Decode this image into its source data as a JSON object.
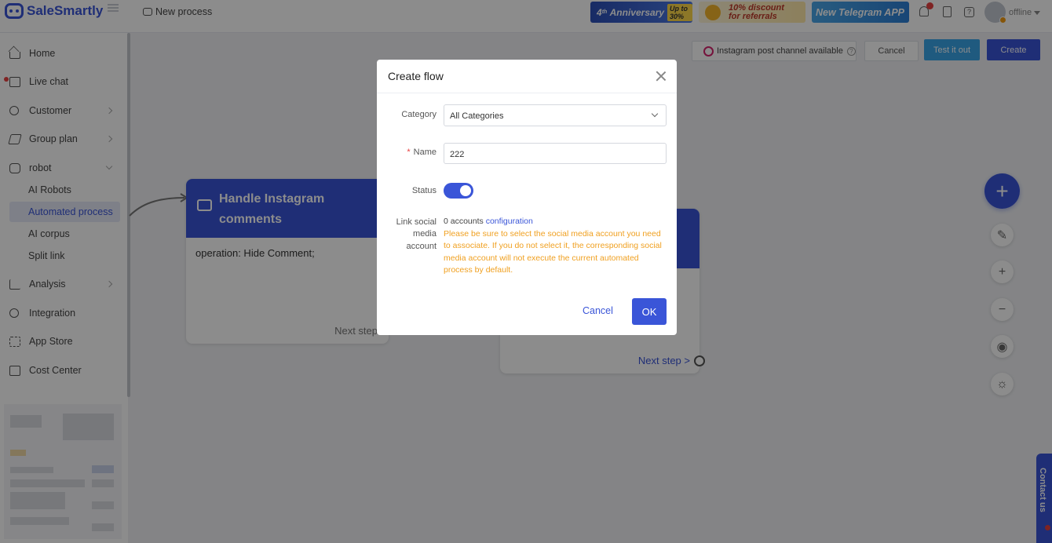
{
  "app": {
    "logo_text": "SaleSmartly",
    "process_title": "New process",
    "banners": {
      "anniversary": "Anniversary",
      "anniversary_superscript": "th",
      "anniversary_number": "4",
      "anniversary_tag": "Up to 30%",
      "discount_line1": "10% discount",
      "discount_line2": "for referrals",
      "telegram": "New Telegram APP"
    },
    "status": "offline"
  },
  "sidebar": {
    "items": [
      {
        "label": "Home",
        "icon": "home-icon"
      },
      {
        "label": "Live chat",
        "icon": "chat-icon"
      },
      {
        "label": "Customer",
        "icon": "customer-icon"
      },
      {
        "label": "Group plan",
        "icon": "send-icon"
      },
      {
        "label": "robot",
        "icon": "robot-icon"
      },
      {
        "label": "Analysis",
        "icon": "analysis-icon"
      },
      {
        "label": "Integration",
        "icon": "integration-icon"
      },
      {
        "label": "App Store",
        "icon": "app-store-icon"
      },
      {
        "label": "Cost Center",
        "icon": "cost-center-icon"
      }
    ],
    "robot_sub": [
      "AI Robots",
      "Automated process",
      "AI corpus",
      "Split link"
    ],
    "active_sub": "Automated process"
  },
  "toolbar": {
    "instagram_notice": "Instagram post channel available",
    "cancel": "Cancel",
    "test": "Test it out",
    "create": "Create"
  },
  "canvas": {
    "card1": {
      "title_line1": "Handle Instagram",
      "title_line2": "comments",
      "body": "operation: Hide Comment;",
      "next": "Next step"
    },
    "card2": {
      "next": "Next step >"
    }
  },
  "modal": {
    "title": "Create flow",
    "category_label": "Category",
    "category_value": "All Categories",
    "name_label": "Name",
    "name_required_mark": "*",
    "name_value": "222",
    "status_label": "Status",
    "status_on": true,
    "link_label_1": "Link social",
    "link_label_2": "media",
    "link_label_3": "account",
    "accounts_text": "0 accounts",
    "configuration_link": "configuration",
    "warning": "Please be sure to select the social media account you need to associate. If you do not select it, the corresponding social media account will not execute the current automated process by default.",
    "cancel": "Cancel",
    "ok": "OK"
  },
  "contact_us": "Contact us",
  "colors": {
    "brand": "#3a55d8",
    "warning": "#f0a020",
    "test_button": "#3aa5e8"
  }
}
